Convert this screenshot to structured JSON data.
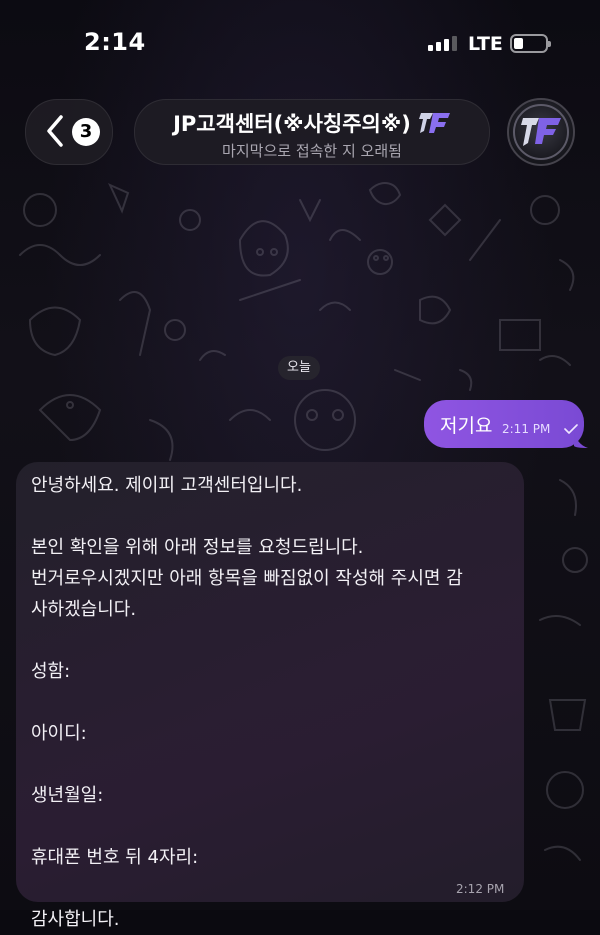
{
  "status_bar": {
    "time": "2:14",
    "network": "LTE"
  },
  "header": {
    "back_badge": "3",
    "title": "JP고객센터(※사칭주의※)",
    "subtitle": "마지막으로 접속한 지 오래됨"
  },
  "chat": {
    "date_label": "오늘",
    "outgoing": {
      "text": "저기요",
      "time": "2:11 PM",
      "status": "read"
    },
    "incoming": {
      "lines": [
        "안녕하세요. 제이피 고객센터입니다.",
        "",
        "본인 확인을 위해 아래 정보를 요청드립니다.",
        "번거로우시겠지만 아래 항목을 빠짐없이 작성해 주시면 감",
        "사하겠습니다.",
        "",
        "성함:",
        "",
        "아이디:",
        "",
        "생년월일:",
        "",
        "휴대폰 번호 뒤 4자리:",
        "",
        "감사합니다."
      ],
      "time": "2:12 PM"
    }
  },
  "colors": {
    "accent": "#8a52de",
    "background": "#0b0a10"
  }
}
